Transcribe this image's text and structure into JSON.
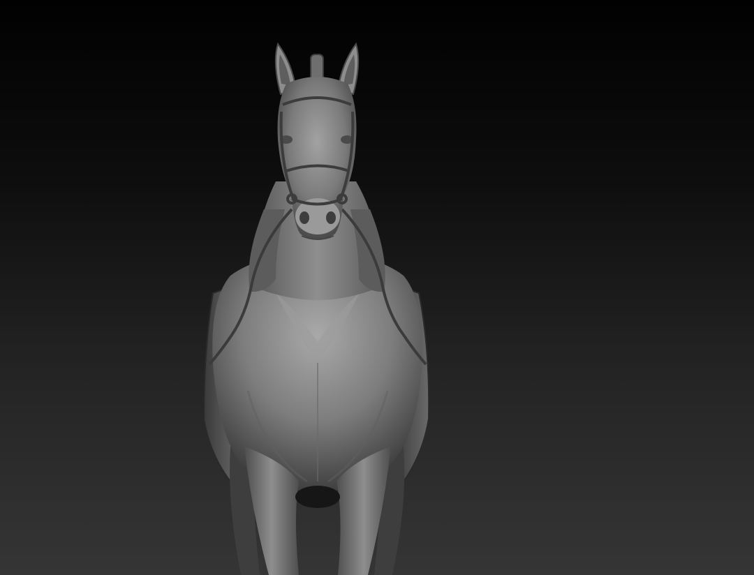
{
  "scene": {
    "subject": "horse-sculpt",
    "background_top": "#010101",
    "background_bottom": "#353535",
    "material_color": "#8a8a8a"
  }
}
